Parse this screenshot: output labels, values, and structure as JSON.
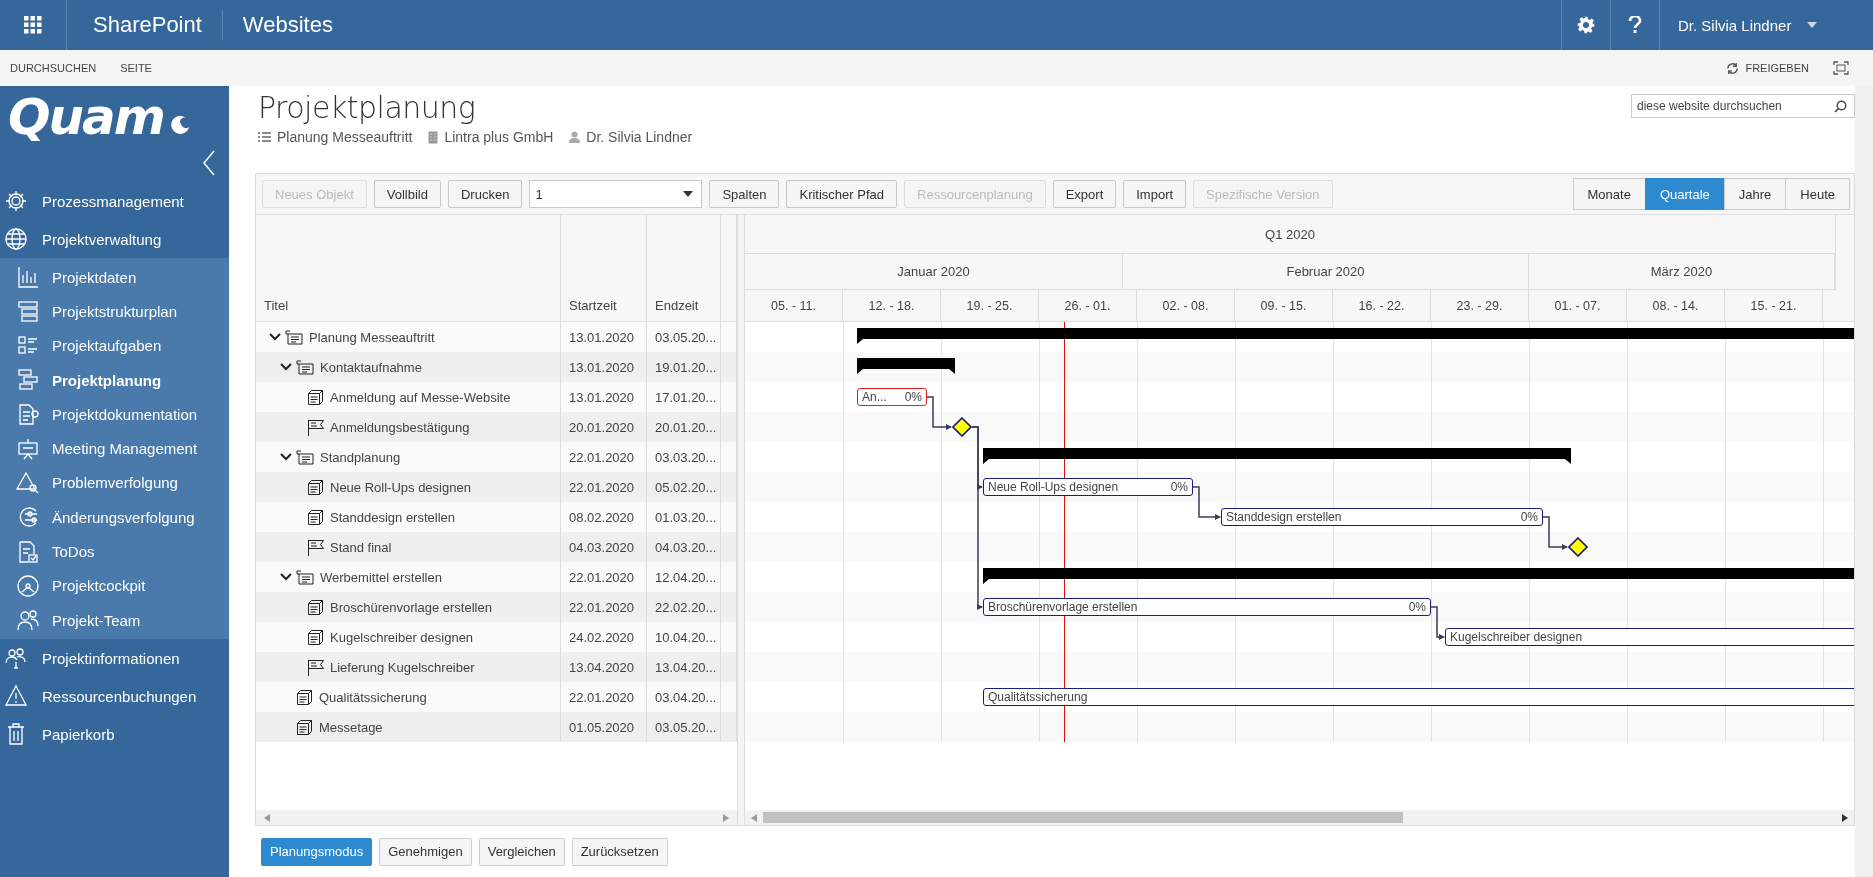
{
  "topbar": {
    "brand": "SharePoint",
    "site": "Websites",
    "user": "Dr. Silvia Lindner"
  },
  "ribbon": {
    "tabs": [
      {
        "label": "DURCHSUCHEN"
      },
      {
        "label": "SEITE"
      }
    ],
    "share": "FREIGEBEN"
  },
  "sidebar": {
    "logo": "Quam",
    "items": [
      {
        "label": "Prozessmanagement",
        "selected": false
      },
      {
        "label": "Projektverwaltung",
        "selected": false,
        "expanded": true,
        "children": [
          {
            "label": "Projektdaten",
            "selected": false
          },
          {
            "label": "Projektstrukturplan",
            "selected": false
          },
          {
            "label": "Projektaufgaben",
            "selected": false
          },
          {
            "label": "Projektplanung",
            "selected": true
          },
          {
            "label": "Projektdokumentation",
            "selected": false
          },
          {
            "label": "Meeting Management",
            "selected": false
          },
          {
            "label": "Problemverfolgung",
            "selected": false
          },
          {
            "label": "Änderungsverfolgung",
            "selected": false
          },
          {
            "label": "ToDos",
            "selected": false
          },
          {
            "label": "Projektcockpit",
            "selected": false
          },
          {
            "label": "Projekt-Team",
            "selected": false
          }
        ]
      },
      {
        "label": "Projektinformationen",
        "selected": false
      },
      {
        "label": "Ressourcenbuchungen",
        "selected": false
      },
      {
        "label": "Papierkorb",
        "selected": false
      }
    ]
  },
  "page": {
    "title": "Projektplanung",
    "project": "Planung Messeauftritt",
    "company": "Lintra plus GmbH",
    "owner": "Dr. Silvia Lindner",
    "search": {
      "placeholder": "diese website durchsuchen"
    }
  },
  "toolbar": {
    "items": [
      {
        "kind": "button",
        "label": "Neues Objekt",
        "disabled": true
      },
      {
        "kind": "button",
        "label": "Vollbild",
        "disabled": false
      },
      {
        "kind": "button",
        "label": "Drucken",
        "disabled": false
      },
      {
        "kind": "select",
        "value": "1",
        "disabled": false
      },
      {
        "kind": "button",
        "label": "Spalten",
        "disabled": false
      },
      {
        "kind": "button",
        "label": "Kritischer Pfad",
        "disabled": false
      },
      {
        "kind": "button",
        "label": "Ressourcenplanung",
        "disabled": true
      },
      {
        "kind": "button",
        "label": "Export",
        "disabled": false
      },
      {
        "kind": "button",
        "label": "Import",
        "disabled": false
      },
      {
        "kind": "button",
        "label": "Spezifische Version",
        "disabled": true
      }
    ],
    "views": [
      {
        "label": "Monate",
        "selected": false
      },
      {
        "label": "Quartale",
        "selected": true
      },
      {
        "label": "Jahre",
        "selected": false
      },
      {
        "label": "Heute",
        "selected": false
      }
    ]
  },
  "table": {
    "columns": [
      "Titel",
      "Startzeit",
      "Endzeit"
    ],
    "rows": [
      {
        "kind": "summary",
        "title": "Planung Messeauftritt",
        "start": "13.01.2020",
        "end": "03.05.20...",
        "expanded": true,
        "children": [
          {
            "kind": "summary",
            "title": "Kontaktaufnahme",
            "start": "13.01.2020",
            "end": "19.01.20...",
            "expanded": true,
            "children": [
              {
                "kind": "task",
                "title": "Anmeldung auf Messe-Website",
                "start": "13.01.2020",
                "end": "17.01.20...",
                "bar_label": "An...",
                "bar_percent": "0%",
                "critical": true
              },
              {
                "kind": "milestone",
                "title": "Anmeldungsbestätigung",
                "start": "20.01.2020",
                "end": "20.01.20...",
                "linked": true
              }
            ]
          },
          {
            "kind": "summary",
            "title": "Standplanung",
            "start": "22.01.2020",
            "end": "03.03.20...",
            "expanded": true,
            "children": [
              {
                "kind": "task",
                "title": "Neue Roll-Ups designen",
                "start": "22.01.2020",
                "end": "05.02.20...",
                "bar_label": "Neue Roll-Ups designen",
                "bar_percent": "0%",
                "critical": false,
                "linked": true
              },
              {
                "kind": "task",
                "title": "Standdesign erstellen",
                "start": "08.02.2020",
                "end": "01.03.20...",
                "bar_label": "Standdesign erstellen",
                "bar_percent": "0%",
                "critical": false,
                "linked": true
              },
              {
                "kind": "milestone",
                "title": "Stand final",
                "start": "04.03.2020",
                "end": "04.03.20...",
                "linked": true
              }
            ]
          },
          {
            "kind": "summary",
            "title": "Werbemittel erstellen",
            "start": "22.01.2020",
            "end": "12.04.20...",
            "expanded": true,
            "children": [
              {
                "kind": "task",
                "title": "Broschürenvorlage erstellen",
                "start": "22.01.2020",
                "end": "22.02.20...",
                "bar_label": "Broschürenvorlage erstellen",
                "bar_percent": "0%",
                "critical": false,
                "linked": true
              },
              {
                "kind": "task",
                "title": "Kugelschreiber designen",
                "start": "24.02.2020",
                "end": "10.04.20...",
                "bar_label": "Kugelschreiber designen",
                "critical": false,
                "linked": true
              },
              {
                "kind": "milestone",
                "title": "Lieferung Kugelschreiber",
                "start": "13.04.2020",
                "end": "13.04.20..."
              }
            ]
          },
          {
            "kind": "task",
            "title": "Qualitätssicherung",
            "start": "22.01.2020",
            "end": "03.04.20...",
            "bar_label": "Qualitätssicherung"
          },
          {
            "kind": "task",
            "title": "Messetage",
            "start": "01.05.2020",
            "end": "03.05.20..."
          }
        ]
      }
    ]
  },
  "timeline": {
    "quarter": "Q1 2020",
    "months": [
      "Januar 2020",
      "Februar 2020",
      "März 2020"
    ],
    "weeks": [
      "05. - 11.",
      "12. - 18.",
      "19. - 25.",
      "26. - 01.",
      "02. - 08.",
      "09. - 15.",
      "16. - 22.",
      "23. - 29.",
      "01. - 07.",
      "08. - 14.",
      "15. - 21."
    ]
  },
  "footer_buttons": [
    {
      "label": "Planungsmodus",
      "selected": true
    },
    {
      "label": "Genehmigen",
      "selected": false
    },
    {
      "label": "Vergleichen",
      "selected": false
    },
    {
      "label": "Zurücksetzen",
      "selected": false
    }
  ]
}
